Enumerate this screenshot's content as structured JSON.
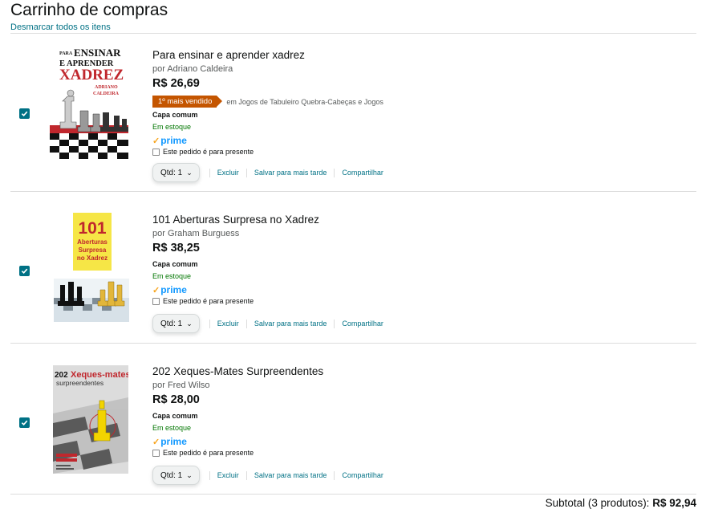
{
  "cart": {
    "title": "Carrinho de compras",
    "deselect_all": "Desmarcar todos os itens"
  },
  "items": [
    {
      "title": "Para ensinar e aprender xadrez",
      "author": "por Adriano Caldeira",
      "price": "R$ 26,69",
      "bestseller_badge": "1º mais vendido",
      "bestseller_category": "em Jogos de Tabuleiro Quebra-Cabeças e Jogos",
      "format": "Capa comum",
      "stock": "Em estoque",
      "prime": "prime",
      "gift": "Este pedido é para presente",
      "qty": "Qtd: 1",
      "delete": "Excluir",
      "save_later": "Salvar para mais tarde",
      "share": "Compartilhar",
      "selected": true,
      "cover": {
        "line1": "PARA",
        "line2": "ENSINAR",
        "line3": "E APRENDER",
        "line4": "XADREZ",
        "line5": "ADRIANO",
        "line6": "CALDEIRA"
      }
    },
    {
      "title": "101 Aberturas Surpresa no Xadrez",
      "author": "por Graham Burguess",
      "price": "R$ 38,25",
      "format": "Capa comum",
      "stock": "Em estoque",
      "prime": "prime",
      "gift": "Este pedido é para presente",
      "qty": "Qtd: 1",
      "delete": "Excluir",
      "save_later": "Salvar para mais tarde",
      "share": "Compartilhar",
      "selected": true,
      "cover": {
        "line1": "101",
        "line2": "Aberturas",
        "line3": "Surpresa",
        "line4": "no Xadrez"
      }
    },
    {
      "title": "202 Xeques-Mates Surpreendentes",
      "author": "por Fred Wilso",
      "price": "R$ 28,00",
      "format": "Capa comum",
      "stock": "Em estoque",
      "prime": "prime",
      "gift": "Este pedido é para presente",
      "qty": "Qtd: 1",
      "delete": "Excluir",
      "save_later": "Salvar para mais tarde",
      "share": "Compartilhar",
      "selected": true,
      "cover": {
        "line1": "202",
        "line2": "Xeques-mates",
        "line3": "surpreendentes"
      }
    }
  ],
  "subtotal": {
    "label": "Subtotal (3 produtos):",
    "value": "R$ 92,94"
  },
  "colors": {
    "link": "#007185",
    "checkbox": "#007185",
    "bestseller": "#c45500",
    "in_stock": "#007600",
    "prime_blue": "#1399ff",
    "prime_check": "#f7a41c"
  },
  "icons": {
    "checkbox": "check-icon",
    "qty_dropdown": "chevron-down-icon",
    "prime": "prime-check-icon"
  }
}
